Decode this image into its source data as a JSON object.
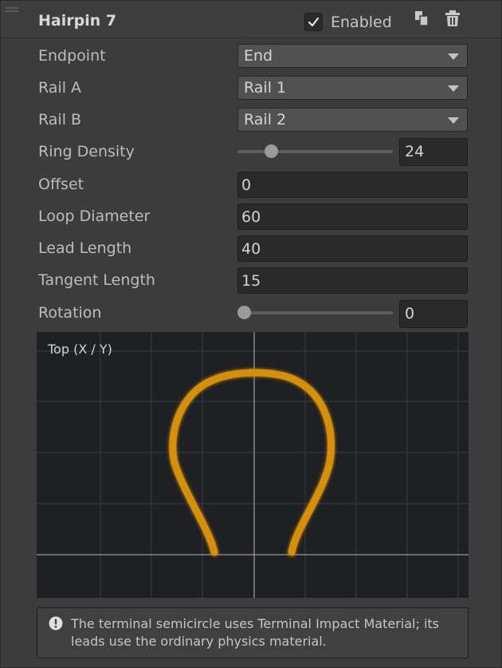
{
  "header": {
    "title": "Hairpin 7",
    "enabled_label": "Enabled",
    "enabled": true,
    "icons": [
      "copy-icon",
      "trash-icon"
    ]
  },
  "fields": {
    "endpoint": {
      "label": "Endpoint",
      "value": "End"
    },
    "rail_a": {
      "label": "Rail A",
      "value": "Rail 1"
    },
    "rail_b": {
      "label": "Rail B",
      "value": "Rail 2"
    },
    "ring_density": {
      "label": "Ring Density",
      "value": "24",
      "slider_fraction": 0.19
    },
    "offset": {
      "label": "Offset",
      "value": "0"
    },
    "loop_diameter": {
      "label": "Loop Diameter",
      "value": "60"
    },
    "lead_length": {
      "label": "Lead Length",
      "value": "40"
    },
    "tangent_length": {
      "label": "Tangent Length",
      "value": "15"
    },
    "rotation": {
      "label": "Rotation",
      "value": "0",
      "slider_fraction": 0.0
    }
  },
  "preview": {
    "label": "Top (X / Y)",
    "curve_color": "#d4900f",
    "grid_color": "#3a3b3f",
    "axis_color": "#b9b9b9"
  },
  "help": {
    "icon": "exclamation-circle-icon",
    "text": "The terminal semicircle uses Terminal Impact Material; its leads use the ordinary physics material."
  },
  "colors": {
    "panel_bg": "#3c3c3c",
    "field_bg": "#2a2a2a",
    "dropdown_bg": "#515151"
  }
}
